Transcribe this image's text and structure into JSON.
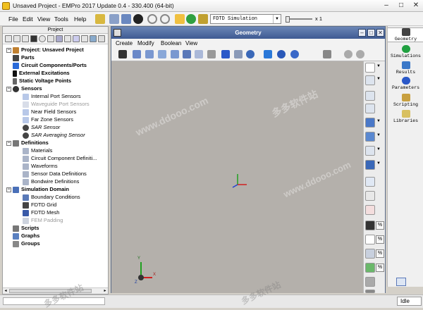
{
  "window": {
    "title": "Unsaved Project - EMPro 2017 Update 0.4 - 330.400 (64-bit)",
    "min_glyph": "–",
    "max_glyph": "□",
    "close_glyph": "✕"
  },
  "menu": {
    "file": "File",
    "edit": "Edit",
    "view": "View",
    "tools": "Tools",
    "help": "Help"
  },
  "toolbar": {
    "sim_select": "FDTD Simulation",
    "zoom_label": "x 1"
  },
  "project_panel": {
    "title": "Project",
    "tree": {
      "project": "Project: Unsaved Project",
      "parts": "Parts",
      "circuit": "Circuit Components/Ports",
      "excitations": "External Excitations",
      "static_voltage": "Static Voltage Points",
      "sensors": "Sensors",
      "internal_port": "Internal Port Sensors",
      "waveguide_port": "Waveguide Port Sensors",
      "near_field": "Near Field Sensors",
      "far_zone": "Far Zone Sensors",
      "sar_sensor": "SAR Sensor",
      "sar_avg": "SAR Averaging Sensor",
      "definitions": "Definitions",
      "materials": "Materials",
      "circuit_def": "Circuit Component Definiti...",
      "waveforms": "Waveforms",
      "sensor_data": "Sensor Data Definitions",
      "bondwire": "Bondwire Definitions",
      "sim_domain": "Simulation Domain",
      "boundary": "Boundary Conditions",
      "fdtd_grid": "FDTD Grid",
      "fdtd_mesh": "FDTD Mesh",
      "fem_padding": "FEM Padding",
      "scripts": "Scripts",
      "graphs": "Graphs",
      "groups": "Groups"
    }
  },
  "geometry": {
    "title": "Geometry",
    "menu": {
      "create": "Create",
      "modify": "Modify",
      "boolean": "Boolean",
      "view": "View"
    },
    "pct": "%",
    "axes": {
      "x": "X",
      "y": "Y",
      "z": "Z"
    }
  },
  "side_tabs": {
    "geometry": "Geometry",
    "simulations": "Simulations",
    "results": "Results",
    "parameters": "Parameters",
    "scripting": "Scripting",
    "libraries": "Libraries"
  },
  "status": {
    "state": "Idle"
  },
  "watermark": {
    "cn": "多多软件站",
    "url": "www.ddooo.com"
  },
  "colors": {
    "canvas": "#b4b0ab",
    "titlebar": "#4a66a0",
    "axis_x": "#d02020",
    "axis_y": "#20a020",
    "axis_z": "#2040d0"
  }
}
